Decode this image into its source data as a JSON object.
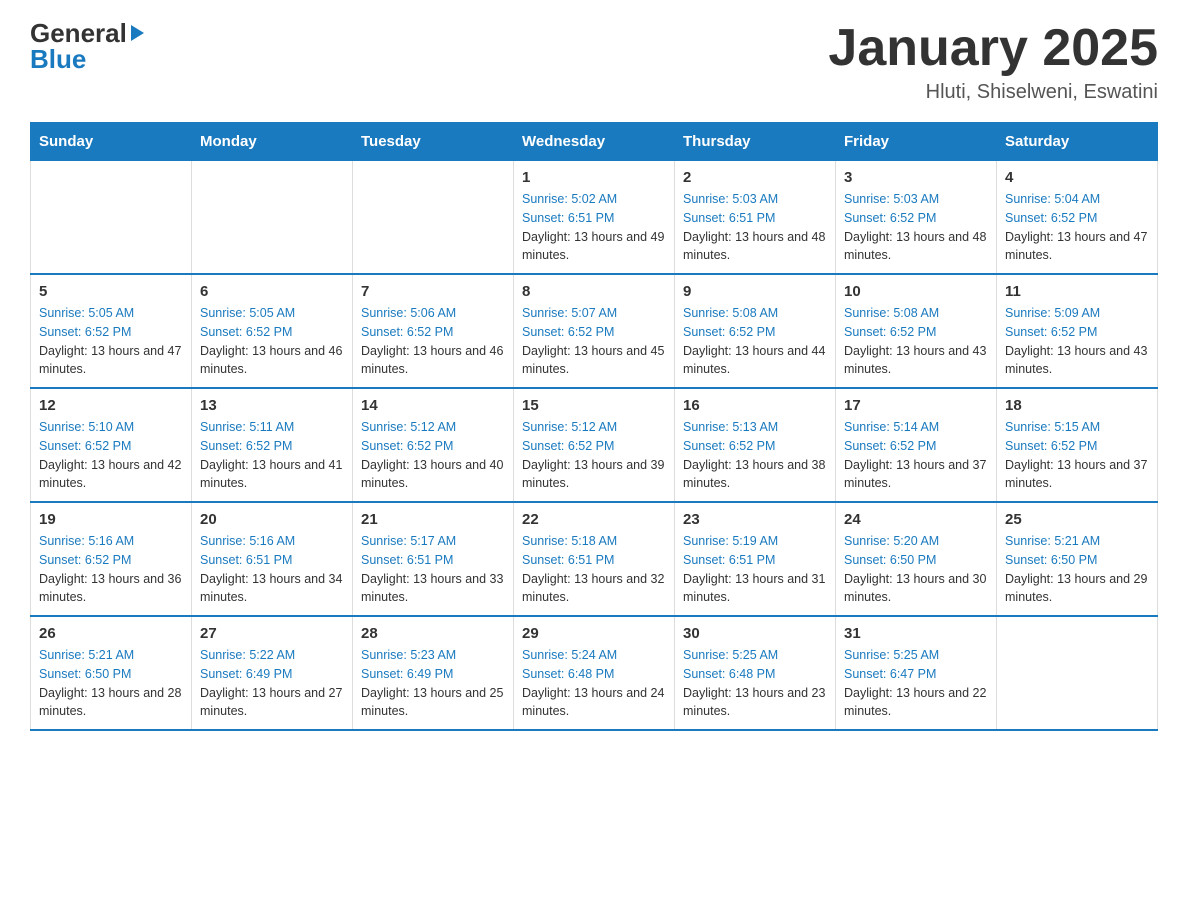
{
  "header": {
    "logo_general": "General",
    "logo_blue": "Blue",
    "title": "January 2025",
    "subtitle": "Hluti, Shiselweni, Eswatini"
  },
  "days_of_week": [
    "Sunday",
    "Monday",
    "Tuesday",
    "Wednesday",
    "Thursday",
    "Friday",
    "Saturday"
  ],
  "weeks": [
    [
      {
        "day": "",
        "sunrise": "",
        "sunset": "",
        "daylight": ""
      },
      {
        "day": "",
        "sunrise": "",
        "sunset": "",
        "daylight": ""
      },
      {
        "day": "",
        "sunrise": "",
        "sunset": "",
        "daylight": ""
      },
      {
        "day": "1",
        "sunrise": "Sunrise: 5:02 AM",
        "sunset": "Sunset: 6:51 PM",
        "daylight": "Daylight: 13 hours and 49 minutes."
      },
      {
        "day": "2",
        "sunrise": "Sunrise: 5:03 AM",
        "sunset": "Sunset: 6:51 PM",
        "daylight": "Daylight: 13 hours and 48 minutes."
      },
      {
        "day": "3",
        "sunrise": "Sunrise: 5:03 AM",
        "sunset": "Sunset: 6:52 PM",
        "daylight": "Daylight: 13 hours and 48 minutes."
      },
      {
        "day": "4",
        "sunrise": "Sunrise: 5:04 AM",
        "sunset": "Sunset: 6:52 PM",
        "daylight": "Daylight: 13 hours and 47 minutes."
      }
    ],
    [
      {
        "day": "5",
        "sunrise": "Sunrise: 5:05 AM",
        "sunset": "Sunset: 6:52 PM",
        "daylight": "Daylight: 13 hours and 47 minutes."
      },
      {
        "day": "6",
        "sunrise": "Sunrise: 5:05 AM",
        "sunset": "Sunset: 6:52 PM",
        "daylight": "Daylight: 13 hours and 46 minutes."
      },
      {
        "day": "7",
        "sunrise": "Sunrise: 5:06 AM",
        "sunset": "Sunset: 6:52 PM",
        "daylight": "Daylight: 13 hours and 46 minutes."
      },
      {
        "day": "8",
        "sunrise": "Sunrise: 5:07 AM",
        "sunset": "Sunset: 6:52 PM",
        "daylight": "Daylight: 13 hours and 45 minutes."
      },
      {
        "day": "9",
        "sunrise": "Sunrise: 5:08 AM",
        "sunset": "Sunset: 6:52 PM",
        "daylight": "Daylight: 13 hours and 44 minutes."
      },
      {
        "day": "10",
        "sunrise": "Sunrise: 5:08 AM",
        "sunset": "Sunset: 6:52 PM",
        "daylight": "Daylight: 13 hours and 43 minutes."
      },
      {
        "day": "11",
        "sunrise": "Sunrise: 5:09 AM",
        "sunset": "Sunset: 6:52 PM",
        "daylight": "Daylight: 13 hours and 43 minutes."
      }
    ],
    [
      {
        "day": "12",
        "sunrise": "Sunrise: 5:10 AM",
        "sunset": "Sunset: 6:52 PM",
        "daylight": "Daylight: 13 hours and 42 minutes."
      },
      {
        "day": "13",
        "sunrise": "Sunrise: 5:11 AM",
        "sunset": "Sunset: 6:52 PM",
        "daylight": "Daylight: 13 hours and 41 minutes."
      },
      {
        "day": "14",
        "sunrise": "Sunrise: 5:12 AM",
        "sunset": "Sunset: 6:52 PM",
        "daylight": "Daylight: 13 hours and 40 minutes."
      },
      {
        "day": "15",
        "sunrise": "Sunrise: 5:12 AM",
        "sunset": "Sunset: 6:52 PM",
        "daylight": "Daylight: 13 hours and 39 minutes."
      },
      {
        "day": "16",
        "sunrise": "Sunrise: 5:13 AM",
        "sunset": "Sunset: 6:52 PM",
        "daylight": "Daylight: 13 hours and 38 minutes."
      },
      {
        "day": "17",
        "sunrise": "Sunrise: 5:14 AM",
        "sunset": "Sunset: 6:52 PM",
        "daylight": "Daylight: 13 hours and 37 minutes."
      },
      {
        "day": "18",
        "sunrise": "Sunrise: 5:15 AM",
        "sunset": "Sunset: 6:52 PM",
        "daylight": "Daylight: 13 hours and 37 minutes."
      }
    ],
    [
      {
        "day": "19",
        "sunrise": "Sunrise: 5:16 AM",
        "sunset": "Sunset: 6:52 PM",
        "daylight": "Daylight: 13 hours and 36 minutes."
      },
      {
        "day": "20",
        "sunrise": "Sunrise: 5:16 AM",
        "sunset": "Sunset: 6:51 PM",
        "daylight": "Daylight: 13 hours and 34 minutes."
      },
      {
        "day": "21",
        "sunrise": "Sunrise: 5:17 AM",
        "sunset": "Sunset: 6:51 PM",
        "daylight": "Daylight: 13 hours and 33 minutes."
      },
      {
        "day": "22",
        "sunrise": "Sunrise: 5:18 AM",
        "sunset": "Sunset: 6:51 PM",
        "daylight": "Daylight: 13 hours and 32 minutes."
      },
      {
        "day": "23",
        "sunrise": "Sunrise: 5:19 AM",
        "sunset": "Sunset: 6:51 PM",
        "daylight": "Daylight: 13 hours and 31 minutes."
      },
      {
        "day": "24",
        "sunrise": "Sunrise: 5:20 AM",
        "sunset": "Sunset: 6:50 PM",
        "daylight": "Daylight: 13 hours and 30 minutes."
      },
      {
        "day": "25",
        "sunrise": "Sunrise: 5:21 AM",
        "sunset": "Sunset: 6:50 PM",
        "daylight": "Daylight: 13 hours and 29 minutes."
      }
    ],
    [
      {
        "day": "26",
        "sunrise": "Sunrise: 5:21 AM",
        "sunset": "Sunset: 6:50 PM",
        "daylight": "Daylight: 13 hours and 28 minutes."
      },
      {
        "day": "27",
        "sunrise": "Sunrise: 5:22 AM",
        "sunset": "Sunset: 6:49 PM",
        "daylight": "Daylight: 13 hours and 27 minutes."
      },
      {
        "day": "28",
        "sunrise": "Sunrise: 5:23 AM",
        "sunset": "Sunset: 6:49 PM",
        "daylight": "Daylight: 13 hours and 25 minutes."
      },
      {
        "day": "29",
        "sunrise": "Sunrise: 5:24 AM",
        "sunset": "Sunset: 6:48 PM",
        "daylight": "Daylight: 13 hours and 24 minutes."
      },
      {
        "day": "30",
        "sunrise": "Sunrise: 5:25 AM",
        "sunset": "Sunset: 6:48 PM",
        "daylight": "Daylight: 13 hours and 23 minutes."
      },
      {
        "day": "31",
        "sunrise": "Sunrise: 5:25 AM",
        "sunset": "Sunset: 6:47 PM",
        "daylight": "Daylight: 13 hours and 22 minutes."
      },
      {
        "day": "",
        "sunrise": "",
        "sunset": "",
        "daylight": ""
      }
    ]
  ]
}
